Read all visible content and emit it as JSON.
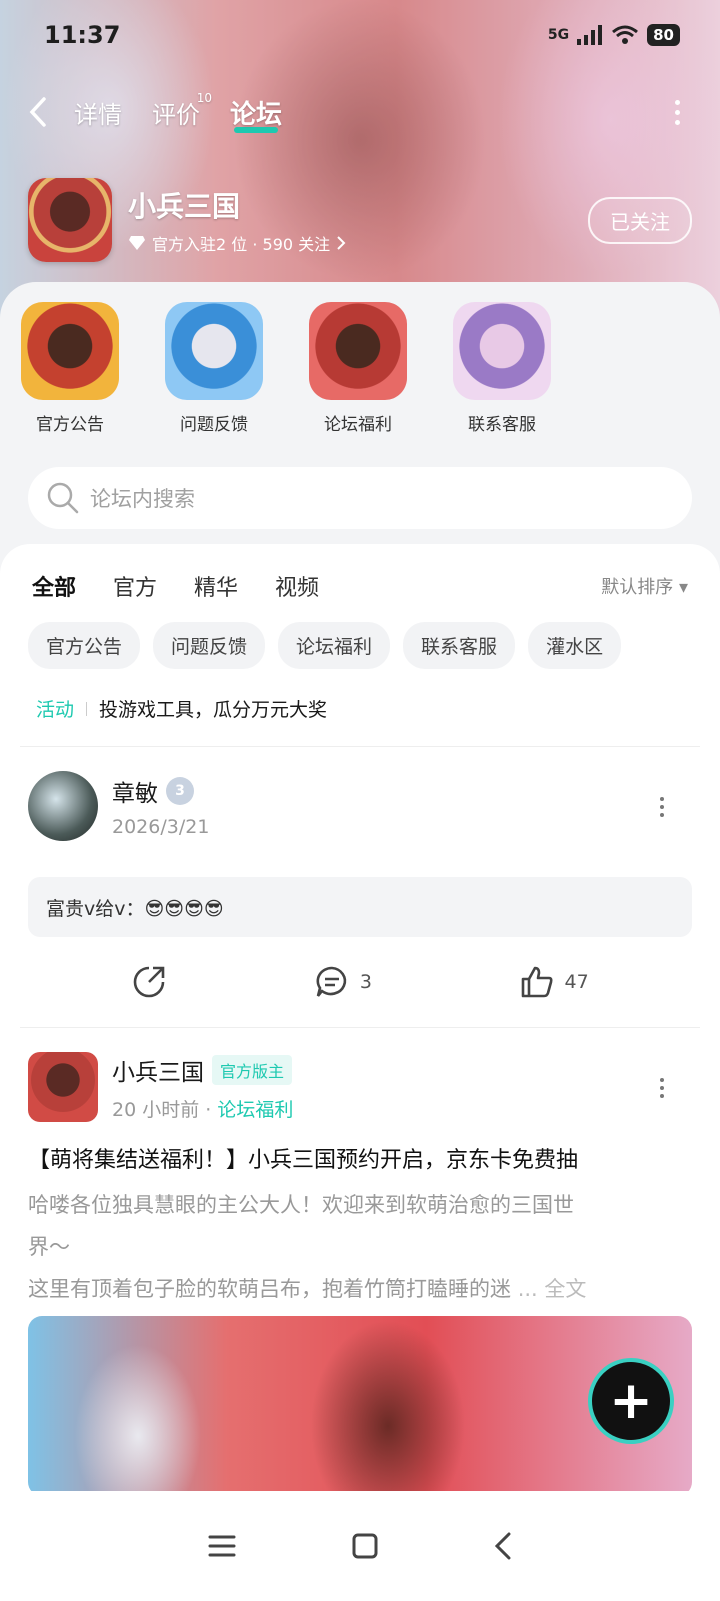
{
  "status": {
    "time": "11:37",
    "network": "5G",
    "battery": "80"
  },
  "nav": {
    "tabs": [
      "详情",
      "评价",
      "论坛"
    ],
    "review_count": "10",
    "active_tab": "论坛"
  },
  "game": {
    "name": "小兵三国",
    "meta": "官方入驻2 位 · 590 关注",
    "follow_label": "已关注"
  },
  "quick_entries": [
    "官方公告",
    "问题反馈",
    "论坛福利",
    "联系客服"
  ],
  "search": {
    "placeholder": "论坛内搜索"
  },
  "feed_tabs": [
    "全部",
    "官方",
    "精华",
    "视频"
  ],
  "sort_label": "默认排序",
  "chips": [
    "官方公告",
    "问题反馈",
    "论坛福利",
    "联系客服",
    "灌水区"
  ],
  "activity": {
    "tag": "活动",
    "text": "投游戏工具，瓜分万元大奖"
  },
  "post1": {
    "author": "章敏",
    "level": "3",
    "date": "2026/3/21",
    "quote": "富贵v给v：😎😎😎😎",
    "comments": "3",
    "likes": "47"
  },
  "post2": {
    "author": "小兵三国",
    "badge": "官方版主",
    "time": "20 小时前",
    "forum": "论坛福利",
    "title": "【萌将集结送福利！】小兵三国预约开启，京东卡免费抽",
    "line1": "哈喽各位独具慧眼的主公大人！欢迎来到软萌治愈的三国世",
    "line2": "界～",
    "line3": "这里有顶着包子脸的软萌吕布，抱着竹筒打瞌睡的迷",
    "more": "... 全文"
  },
  "colors": {
    "accent": "#1ec9b0"
  }
}
